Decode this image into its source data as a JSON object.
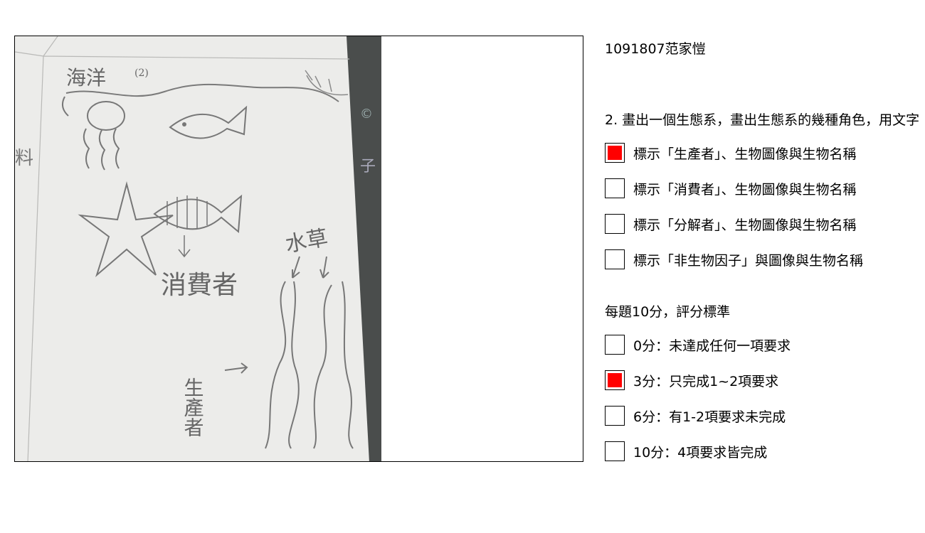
{
  "student": {
    "name": "1091807范家愷"
  },
  "question": {
    "text": "2. 畫出一個生態系，畫出生態系的幾種角色，用文字"
  },
  "drawing": {
    "labels": [
      "海洋",
      "(2)",
      "消費者",
      "水草",
      "生產者"
    ]
  },
  "criteria": {
    "items": [
      {
        "label": "標示「生產者」、生物圖像與生物名稱",
        "checked": true
      },
      {
        "label": "標示「消費者」、生物圖像與生物名稱",
        "checked": false
      },
      {
        "label": "標示「分解者」、生物圖像與生物名稱",
        "checked": false
      },
      {
        "label": "標示「非生物因子」與圖像與生物名稱",
        "checked": false
      }
    ]
  },
  "scoring": {
    "heading": "每題10分，評分標準",
    "items": [
      {
        "label": "0分：未達成任何一項要求",
        "checked": false
      },
      {
        "label": "3分：只完成1~2項要求",
        "checked": true
      },
      {
        "label": "6分：有1-2項要求未完成",
        "checked": false
      },
      {
        "label": "10分：4項要求皆完成",
        "checked": false
      }
    ]
  },
  "colors": {
    "check_fill": "#ff0000",
    "paper": "#ececea",
    "desk": "#4a4d4c"
  }
}
